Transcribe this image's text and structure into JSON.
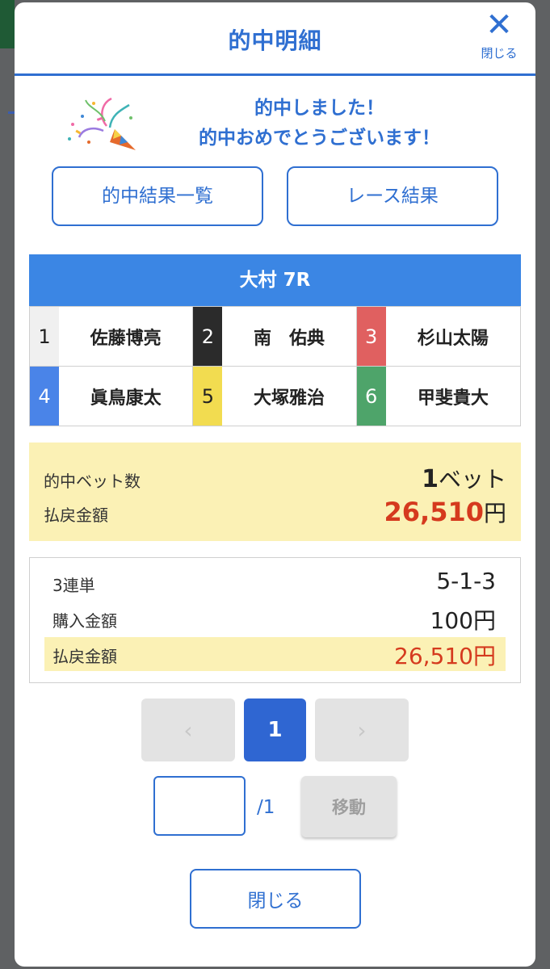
{
  "header": {
    "title": "的中明細",
    "close_label": "閉じる"
  },
  "congrats": {
    "line1": "的中しました！",
    "line2": "的中おめでとうございます！",
    "icon": "party-popper-icon"
  },
  "buttons": {
    "hit_list": "的中結果一覧",
    "race_result": "レース結果"
  },
  "race": {
    "title": "大村 7R",
    "racers": [
      {
        "num": "1",
        "name": "佐藤博亮",
        "bg": "#f0f0f0",
        "fg": "#222222"
      },
      {
        "num": "2",
        "name": "南　佑典",
        "bg": "#2b2b2b",
        "fg": "#ffffff"
      },
      {
        "num": "3",
        "name": "杉山太陽",
        "bg": "#e06060",
        "fg": "#ffffff"
      },
      {
        "num": "4",
        "name": "眞鳥康太",
        "bg": "#4a84e8",
        "fg": "#ffffff"
      },
      {
        "num": "5",
        "name": "大塚雅治",
        "bg": "#f2dc50",
        "fg": "#222222"
      },
      {
        "num": "6",
        "name": "甲斐貴大",
        "bg": "#4ea46a",
        "fg": "#ffffff"
      }
    ]
  },
  "summary": {
    "bets_label": "的中ベット数",
    "bets_value": "1",
    "bets_unit": "ベット",
    "payout_label": "払戻金額",
    "payout_value": "26,510",
    "payout_unit": "円"
  },
  "detail": {
    "type_label": "3連単",
    "type_value": "5-1-3",
    "purchase_label": "購入金額",
    "purchase_value": "100円",
    "payout_label": "払戻金額",
    "payout_value": "26,510円"
  },
  "pager": {
    "prev": "‹",
    "current": "1",
    "next": "›"
  },
  "jump": {
    "total": "/1",
    "button": "移動"
  },
  "footer": {
    "close": "閉じる"
  },
  "colors": {
    "accent": "#2f6fd1",
    "highlight": "#fbf1b5",
    "payout": "#d53a1e"
  }
}
